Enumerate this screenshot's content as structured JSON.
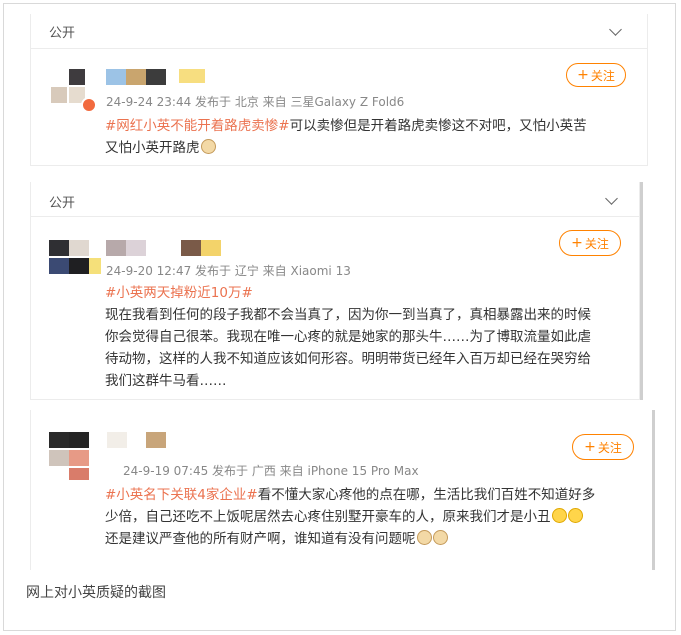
{
  "posts": [
    {
      "visibility": "公开",
      "meta": "24-9-24 23:44 发布于 北京 来自 三星Galaxy Z Fold6",
      "follow_label": "关注",
      "tag": "#网红小英不能开着路虎卖惨#",
      "text_line1": "可以卖惨但是开着路虎卖惨这不对吧，又怕小英苦",
      "text_line2": "又怕小英开路虎"
    },
    {
      "visibility": "公开",
      "meta": "24-9-20 12:47 发布于 辽宁 来自 Xiaomi 13",
      "follow_label": "关注",
      "tag": "#小英两天掉粉近10万#",
      "lines": [
        "现在我看到任何的段子我都不会当真了，因为你一到当真了，真相暴露出来的时候",
        "你会觉得自己很苯。我现在唯一心疼的就是她家的那头牛……为了博取流量如此虐",
        "待动物，这样的人我不知道应该如何形容。明明带货已经年入百万却已经在哭穷给",
        "我们这群牛马看……"
      ]
    },
    {
      "meta": "24-9-19 07:45 发布于 广西 来自 iPhone 15 Pro Max",
      "follow_label": "关注",
      "tag": "#小英名下关联4家企业#",
      "text_line1": "看不懂大家心疼他的点在哪，生活比我们百姓不知道好多",
      "text_line2": "少倍，自己还吃不上饭呢居然去心疼住别墅开豪车的人，原来我们才是小丑",
      "text_line3": "还是建议严查他的所有财产啊，谁知道有没有问题呢"
    }
  ],
  "caption": "网上对小英质疑的截图",
  "colors": {
    "accent": "#ff8200",
    "tag": "#eb7350"
  },
  "icons": [
    "chevron-down-icon",
    "plus-icon",
    "verified-badge-icon",
    "emoji-icon"
  ]
}
